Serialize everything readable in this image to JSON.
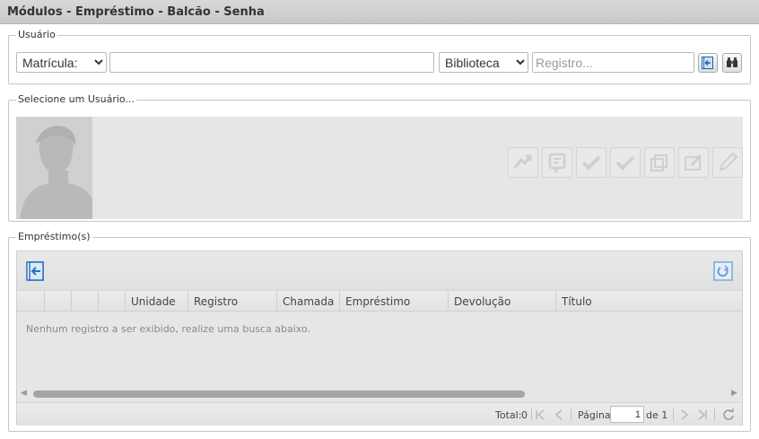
{
  "window": {
    "title": "Módulos - Empréstimo - Balcão - Senha"
  },
  "usuario": {
    "legend": "Usuário",
    "search_type": {
      "selected": "Matrícula:"
    },
    "search_value": "",
    "library": {
      "selected": "Biblioteca"
    },
    "registro": {
      "value": "",
      "placeholder": "Registro..."
    }
  },
  "selecione": {
    "legend": "Selecione um Usuário..."
  },
  "emprestimos": {
    "legend": "Empréstimo(s)",
    "columns": [
      "",
      "",
      "",
      "",
      "Unidade",
      "Registro",
      "Chamada",
      "Empréstimo",
      "Devolução",
      "Título"
    ],
    "empty_message": "Nenhum registro a ser exibido, realize uma busca abaixo.",
    "footer": {
      "total_label": "Total:",
      "total_value": "0",
      "page_label": "Página",
      "page_value": "1",
      "of_label": "de 1"
    }
  }
}
